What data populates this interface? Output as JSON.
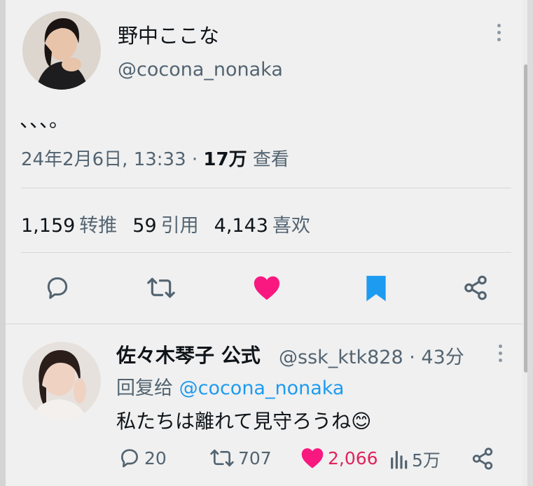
{
  "tweet": {
    "author_name": "野中ここな",
    "author_handle": "@cocona_nonaka",
    "text": "、、、。",
    "timestamp": "24年2月6日, 13:33 · ",
    "views_count": "17万",
    "views_label": " 查看",
    "stats": {
      "retweets_count": "1,159",
      "retweets_label": "转推",
      "quotes_count": "59",
      "quotes_label": "引用",
      "likes_count": "4,143",
      "likes_label": "喜欢"
    },
    "actions": {
      "reply_icon": "reply-icon",
      "retweet_icon": "retweet-icon",
      "like_icon": "heart-icon",
      "bookmark_icon": "bookmark-icon",
      "share_icon": "share-icon"
    }
  },
  "reply": {
    "author_name": "佐々木琴子 公式",
    "author_handle": "@ssk_ktk828",
    "time": " · 43分",
    "reply_to_label": "回复给 ",
    "reply_to_handle": "@cocona_nonaka",
    "text": "私たちは離れて見守ろうね",
    "emoji": "😊",
    "counts": {
      "replies": "20",
      "retweets": "707",
      "likes": "2,066",
      "views": "5万"
    }
  },
  "colors": {
    "like": "#f91880",
    "bookmark": "#1d9bf0",
    "link": "#1d9bf0",
    "muted": "#536471",
    "icon": "#536471"
  }
}
